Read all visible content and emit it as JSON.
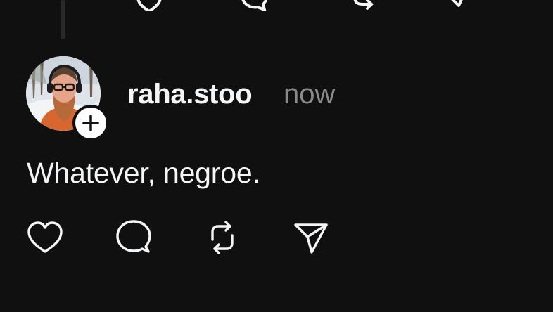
{
  "post": {
    "username": "raha.stoo",
    "timestamp": "now",
    "text": "Whatever, negroe."
  },
  "icons": {
    "prev_like": "heart-icon",
    "prev_comment": "comment-icon",
    "prev_repost": "repost-icon",
    "prev_share": "send-icon",
    "like": "heart-icon",
    "comment": "comment-icon",
    "repost": "repost-icon",
    "share": "send-icon",
    "follow": "plus-icon"
  },
  "colors": {
    "background": "#101010",
    "text": "#f3f5f7",
    "secondary_text": "#8a8a8a",
    "icon_stroke": "#f3f5f7",
    "thread_line": "#2a2a2a"
  }
}
